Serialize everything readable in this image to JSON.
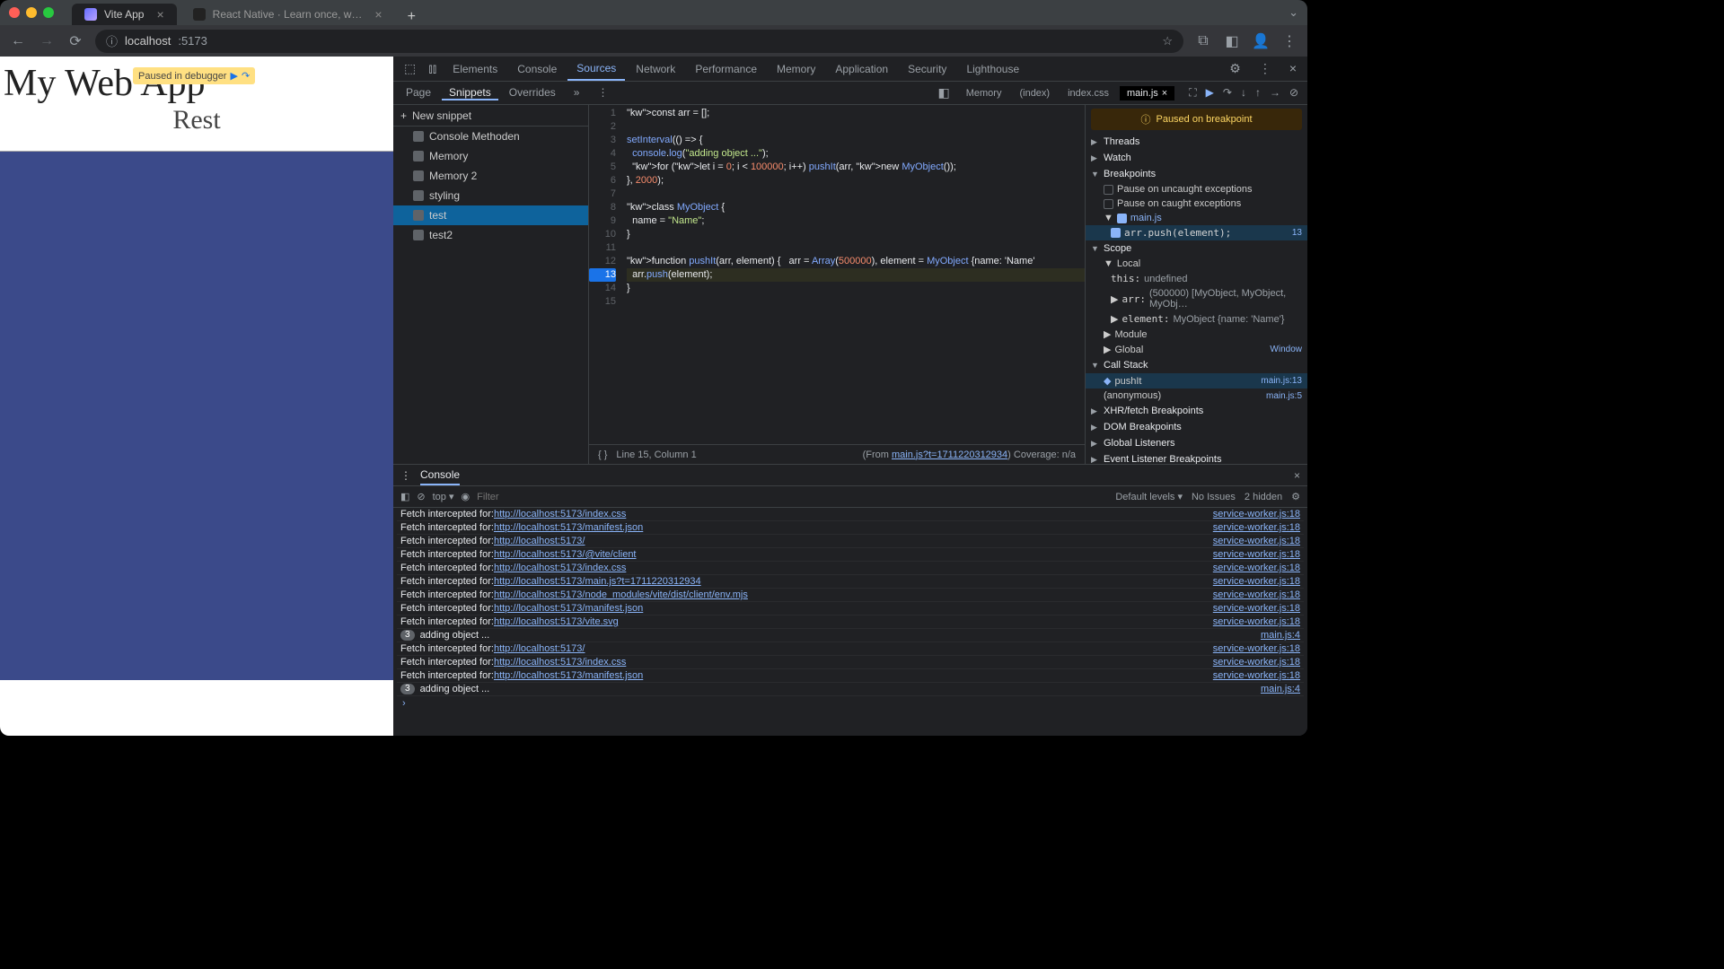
{
  "browser": {
    "tabs": [
      {
        "title": "Vite App",
        "active": true
      },
      {
        "title": "React Native · Learn once, w…",
        "active": false
      }
    ],
    "url_host": "localhost",
    "url_port": ":5173"
  },
  "page": {
    "title": "My Web App",
    "subtitle": "Rest",
    "paused_label": "Paused in debugger"
  },
  "devtools": {
    "panels": [
      "Elements",
      "Console",
      "Sources",
      "Network",
      "Performance",
      "Memory",
      "Application",
      "Security",
      "Lighthouse"
    ],
    "active_panel": "Sources",
    "sub_tabs": [
      "Page",
      "Snippets",
      "Overrides"
    ],
    "sub_active": "Snippets",
    "editor_tabs": [
      "Memory",
      "(index)",
      "index.css",
      "main.js"
    ],
    "editor_active": "main.js",
    "new_snippet_label": "New snippet",
    "snippets": [
      "Console Methoden",
      "Memory",
      "Memory 2",
      "styling",
      "test",
      "test2"
    ],
    "snippet_selected": "test",
    "code_lines": [
      "const arr = [];",
      "",
      "setInterval(() => {",
      "  console.log(\"adding object ...\");",
      "  for (let i = 0; i < 100000; i++) pushIt(arr, new MyObject());",
      "}, 2000);",
      "",
      "class MyObject {",
      "  name = \"Name\";",
      "}",
      "",
      "function pushIt(arr, element) {   arr = Array(500000), element = MyObject {name: 'Name'",
      "  arr.push(element);",
      "}",
      ""
    ],
    "breakpoint_line": 13,
    "status": {
      "pos": "Line 15, Column 1",
      "from": "main.js?t=1711220312934",
      "coverage": "Coverage: n/a"
    }
  },
  "debugger": {
    "paused_msg": "Paused on breakpoint",
    "sections": {
      "threads": "Threads",
      "watch": "Watch",
      "breakpoints": "Breakpoints",
      "uncaught": "Pause on uncaught exceptions",
      "caught": "Pause on caught exceptions",
      "bp_file": "main.js",
      "bp_code": "arr.push(element);",
      "bp_num": "13",
      "scope": "Scope",
      "local": "Local",
      "this_label": "this:",
      "this_val": "undefined",
      "arr_label": "arr:",
      "arr_val": "(500000) [MyObject, MyObject, MyObj…",
      "element_label": "element:",
      "element_val": "MyObject {name: 'Name'}",
      "module": "Module",
      "global": "Global",
      "global_val": "Window",
      "callstack": "Call Stack",
      "cs1": "pushIt",
      "cs1_loc": "main.js:13",
      "cs2": "(anonymous)",
      "cs2_loc": "main.js:5",
      "xhr": "XHR/fetch Breakpoints",
      "dom": "DOM Breakpoints",
      "gl": "Global Listeners",
      "evt": "Event Listener Breakpoints"
    }
  },
  "console": {
    "title": "Console",
    "context": "top",
    "filter_placeholder": "Filter",
    "levels": "Default levels",
    "issues": "No Issues",
    "hidden": "2 hidden",
    "logs": [
      {
        "msg": "Fetch intercepted for: ",
        "url": "http://localhost:5173/index.css",
        "src": "service-worker.js:18"
      },
      {
        "msg": "Fetch intercepted for: ",
        "url": "http://localhost:5173/manifest.json",
        "src": "service-worker.js:18"
      },
      {
        "msg": "Fetch intercepted for: ",
        "url": "http://localhost:5173/",
        "src": "service-worker.js:18"
      },
      {
        "msg": "Fetch intercepted for: ",
        "url": "http://localhost:5173/@vite/client",
        "src": "service-worker.js:18"
      },
      {
        "msg": "Fetch intercepted for: ",
        "url": "http://localhost:5173/index.css",
        "src": "service-worker.js:18"
      },
      {
        "msg": "Fetch intercepted for: ",
        "url": "http://localhost:5173/main.js?t=1711220312934",
        "src": "service-worker.js:18"
      },
      {
        "msg": "Fetch intercepted for: ",
        "url": "http://localhost:5173/node_modules/vite/dist/client/env.mjs",
        "src": "service-worker.js:18"
      },
      {
        "msg": "Fetch intercepted for: ",
        "url": "http://localhost:5173/manifest.json",
        "src": "service-worker.js:18"
      },
      {
        "msg": "Fetch intercepted for: ",
        "url": "http://localhost:5173/vite.svg",
        "src": "service-worker.js:18"
      },
      {
        "badge": "3",
        "msg": "adding object ...",
        "src": "main.js:4"
      },
      {
        "msg": "Fetch intercepted for: ",
        "url": "http://localhost:5173/",
        "src": "service-worker.js:18"
      },
      {
        "msg": "Fetch intercepted for: ",
        "url": "http://localhost:5173/index.css",
        "src": "service-worker.js:18"
      },
      {
        "msg": "Fetch intercepted for: ",
        "url": "http://localhost:5173/manifest.json",
        "src": "service-worker.js:18"
      },
      {
        "badge": "3",
        "msg": "adding object ...",
        "src": "main.js:4"
      }
    ]
  }
}
